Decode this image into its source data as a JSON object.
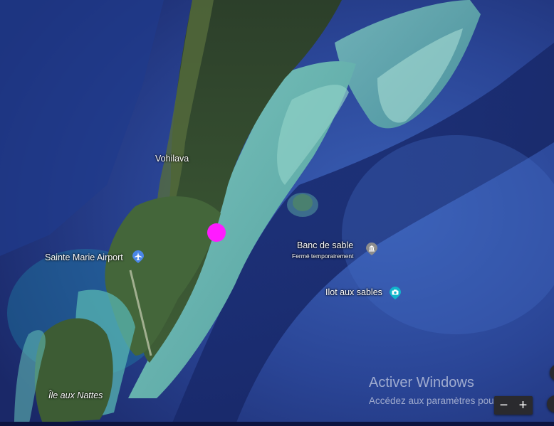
{
  "map": {
    "view": "satellite",
    "places": [
      {
        "name": "Vohilava",
        "kind": "village"
      },
      {
        "name": "Sainte Marie Airport",
        "kind": "airport",
        "icon": "airplane-icon",
        "color": "#4a86e8"
      },
      {
        "name": "Banc de sable",
        "kind": "point-of-interest",
        "status": "Fermé temporairement",
        "icon": "landmark-icon",
        "color": "#8c8c8c"
      },
      {
        "name": "Ilot aux sables",
        "kind": "tourist-attraction",
        "icon": "camera-icon",
        "color": "#12b5cb"
      },
      {
        "name": "Île aux Nattes",
        "kind": "island"
      }
    ],
    "current_location_color": "#ff1bff"
  },
  "watermark": {
    "title": "Activer Windows",
    "subtitle": "Accédez aux paramètres pour activer"
  },
  "controls": {
    "zoom_out": "−",
    "zoom_in": "+"
  },
  "colors": {
    "ocean_deep": "#1b2a6b",
    "ocean_mid": "#2c4c9c",
    "lagoon": "#6fb9b3",
    "land": "#2f4a2a"
  }
}
